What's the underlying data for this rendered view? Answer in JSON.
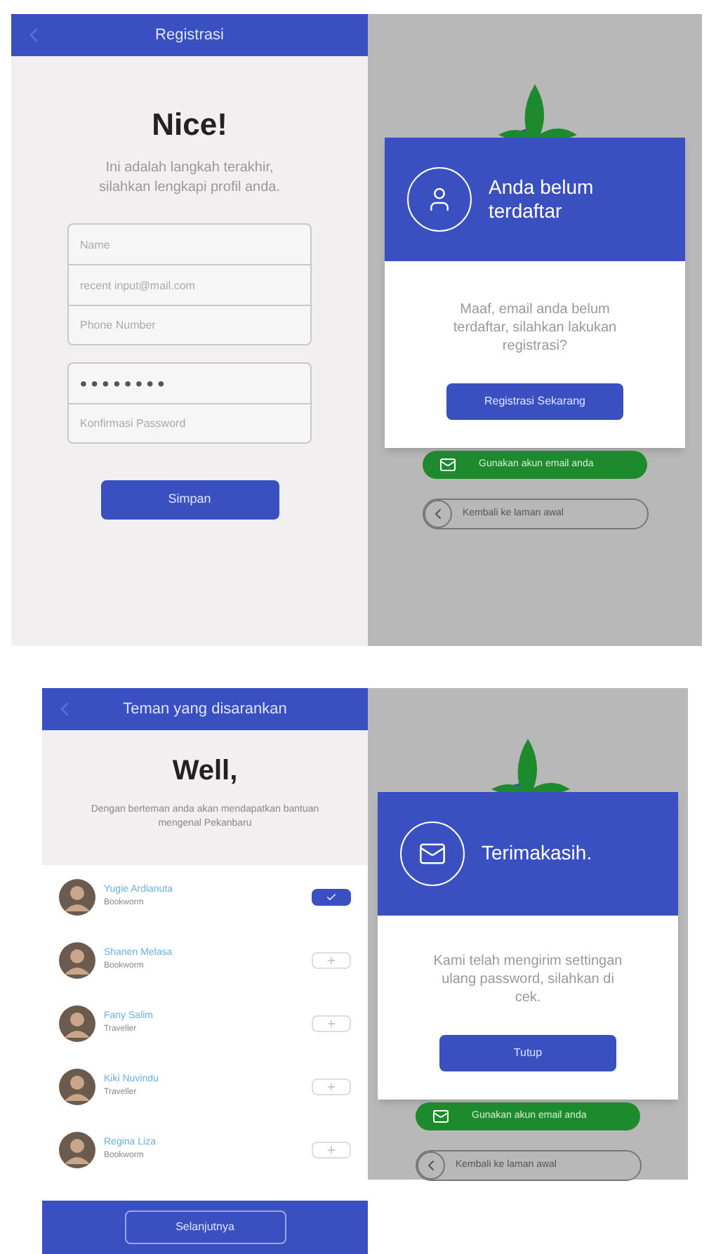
{
  "registration_screen": {
    "title": "Registrasi",
    "heading": "Nice!",
    "subtitle": "Ini adalah langkah terakhir, silahkan lengkapi profil anda.",
    "field_groups": [
      [
        {
          "placeholder": "Name"
        },
        {
          "placeholder": "recent input@mail.com"
        },
        {
          "placeholder": "Phone Number"
        }
      ],
      [
        {
          "value": "••••••••",
          "kind": "password"
        },
        {
          "placeholder": "Konfirmasi Password"
        }
      ]
    ],
    "save_button": "Simpan"
  },
  "not_registered_dialog": {
    "kind": "user",
    "title": "Anda belum terdaftar",
    "message": "Maaf, email anda belum terdaftar, silahkan lakukan registrasi?",
    "button": "Registrasi Sekarang",
    "email_button": "Gunakan akun email anda",
    "back_button": "Kembali ke laman awal"
  },
  "friends_screen": {
    "title": "Teman yang disarankan",
    "heading": "Well,",
    "subtitle": "Dengan berteman anda akan mendapatkan bantuan mengenal Pekanbaru",
    "friends": [
      {
        "name": "Yugie Ardianuta",
        "role": "Bookworm",
        "selected": true
      },
      {
        "name": "Shanen Melasa",
        "role": "Bookworm",
        "selected": false
      },
      {
        "name": "Fany Salim",
        "role": "Traveller",
        "selected": false
      },
      {
        "name": "Kiki Nuvindu",
        "role": "Traveller",
        "selected": false
      },
      {
        "name": "Regina Liza",
        "role": "Bookworm",
        "selected": false
      }
    ],
    "next_button": "Selanjutnya"
  },
  "thanks_dialog": {
    "kind": "mail",
    "title": "Terimakasih.",
    "message": "Kami telah mengirim settingan ulang password, silahkan di cek.",
    "button": "Tutup",
    "email_button": "Gunakan akun email anda",
    "back_button": "Kembali ke laman awal"
  }
}
